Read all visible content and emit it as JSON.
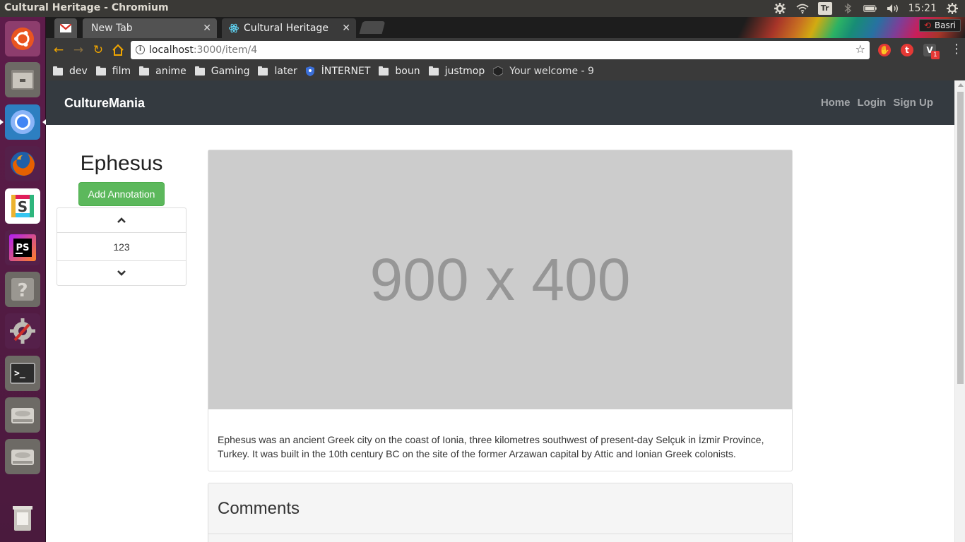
{
  "os": {
    "window_title": "Cultural Heritage - Chromium",
    "tray": {
      "tr_label": "Tr",
      "clock": "15:21"
    },
    "launcher": [
      {
        "name": "ubuntu-dash-icon"
      },
      {
        "name": "files-icon"
      },
      {
        "name": "chromium-icon"
      },
      {
        "name": "firefox-icon"
      },
      {
        "name": "slack-icon"
      },
      {
        "name": "phpstorm-icon",
        "label": "PS"
      },
      {
        "name": "help-icon"
      },
      {
        "name": "system-settings-icon"
      },
      {
        "name": "terminal-icon"
      },
      {
        "name": "drive-icon"
      },
      {
        "name": "drive-icon-2"
      },
      {
        "name": "trash-icon"
      }
    ]
  },
  "browser": {
    "tabs": [
      {
        "label": "New Tab",
        "active": false
      },
      {
        "label": "Cultural Heritage",
        "active": true
      }
    ],
    "profile": "Basri",
    "url": {
      "host": "localhost",
      "path": ":3000/item/4"
    },
    "bookmarks": [
      {
        "label": "dev",
        "type": "folder"
      },
      {
        "label": "film",
        "type": "folder"
      },
      {
        "label": "anime",
        "type": "folder"
      },
      {
        "label": "Gaming",
        "type": "folder"
      },
      {
        "label": "later",
        "type": "folder"
      },
      {
        "label": "İNTERNET",
        "type": "link"
      },
      {
        "label": "boun",
        "type": "folder"
      },
      {
        "label": "justmop",
        "type": "folder"
      },
      {
        "label": "Your welcome - 9",
        "type": "link"
      }
    ],
    "extension_badge": "1"
  },
  "page": {
    "brand": "CultureMania",
    "nav": {
      "home": "Home",
      "login": "Login",
      "signup": "Sign Up"
    },
    "item": {
      "title": "Ephesus",
      "add_annotation": "Add Annotation",
      "vote_count": "123",
      "image_placeholder": "900 x 400",
      "description": "Ephesus was an ancient Greek city on the coast of Ionia, three kilometres southwest of present-day Selçuk in İzmir Province, Turkey. It was built in the 10th century BC on the site of the former Arzawan capital by Attic and Ionian Greek colonists."
    },
    "comments_heading": "Comments"
  }
}
